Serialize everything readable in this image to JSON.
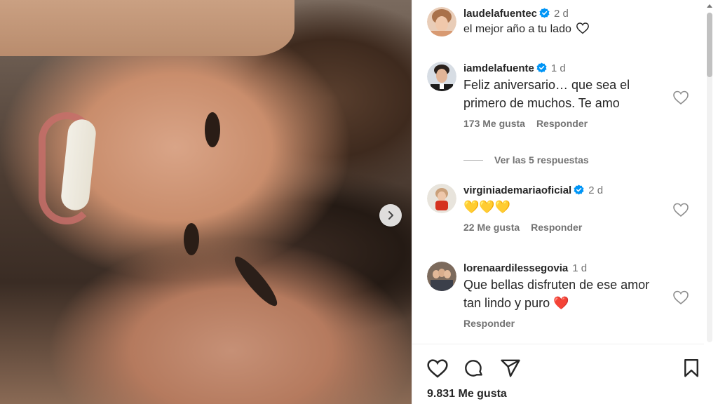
{
  "post": {
    "caption": {
      "username": "laudelafuentec",
      "age": "2 d",
      "text": "el mejor año a tu lado"
    },
    "comments": [
      {
        "username": "iamdelafuente",
        "age": "1 d",
        "text": "Feliz aniversario… que sea el primero de muchos. Te amo",
        "likes": "173 Me gusta",
        "reply_label": "Responder",
        "view_replies": "Ver las 5 respuestas"
      },
      {
        "username": "virginiademariaoficial",
        "age": "2 d",
        "text": "💛💛💛",
        "likes": "22 Me gusta",
        "reply_label": "Responder"
      },
      {
        "username": "lorenaardilessegovia",
        "age": "1 d",
        "text": "Que bellas disfruten de ese amor tan lindo y puro ❤️",
        "reply_label": "Responder"
      }
    ],
    "likes_total": "9.831 Me gusta"
  },
  "icons": {
    "verified": "verified-badge-icon",
    "heart": "heart-icon",
    "comment": "comment-icon",
    "share": "share-icon",
    "save": "bookmark-icon",
    "next": "chevron-right-icon"
  },
  "colors": {
    "verified": "#0095f6",
    "text": "#262626",
    "secondary": "#737373"
  }
}
